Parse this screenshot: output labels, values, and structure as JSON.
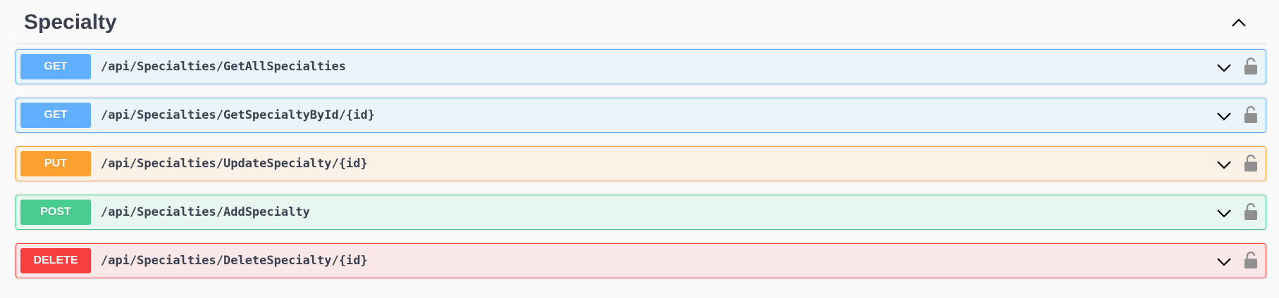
{
  "section": {
    "title": "Specialty",
    "collapse_icon": "chevron-up-icon"
  },
  "operations": [
    {
      "method": "GET",
      "path": "/api/Specialties/GetAllSpecialties",
      "expand_icon": "chevron-down-icon",
      "lock_icon": "unlocked-icon"
    },
    {
      "method": "GET",
      "path": "/api/Specialties/GetSpecialtyById/{id}",
      "expand_icon": "chevron-down-icon",
      "lock_icon": "unlocked-icon"
    },
    {
      "method": "PUT",
      "path": "/api/Specialties/UpdateSpecialty/{id}",
      "expand_icon": "chevron-down-icon",
      "lock_icon": "unlocked-icon"
    },
    {
      "method": "POST",
      "path": "/api/Specialties/AddSpecialty",
      "expand_icon": "chevron-down-icon",
      "lock_icon": "unlocked-icon"
    },
    {
      "method": "DELETE",
      "path": "/api/Specialties/DeleteSpecialty/{id}",
      "expand_icon": "chevron-down-icon",
      "lock_icon": "unlocked-icon"
    }
  ],
  "colors": {
    "get": "#61affe",
    "put": "#fca130",
    "post": "#49cc90",
    "delete": "#f93e3e",
    "text": "#3b4151"
  }
}
